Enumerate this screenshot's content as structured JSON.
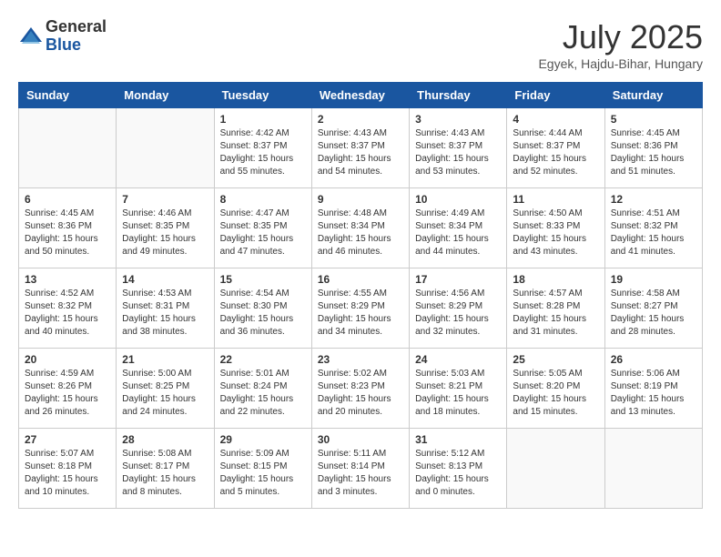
{
  "logo": {
    "general": "General",
    "blue": "Blue"
  },
  "title": {
    "month_year": "July 2025",
    "location": "Egyek, Hajdu-Bihar, Hungary"
  },
  "weekdays": [
    "Sunday",
    "Monday",
    "Tuesday",
    "Wednesday",
    "Thursday",
    "Friday",
    "Saturday"
  ],
  "weeks": [
    [
      {
        "day": "",
        "info": ""
      },
      {
        "day": "",
        "info": ""
      },
      {
        "day": "1",
        "info": "Sunrise: 4:42 AM\nSunset: 8:37 PM\nDaylight: 15 hours and 55 minutes."
      },
      {
        "day": "2",
        "info": "Sunrise: 4:43 AM\nSunset: 8:37 PM\nDaylight: 15 hours and 54 minutes."
      },
      {
        "day": "3",
        "info": "Sunrise: 4:43 AM\nSunset: 8:37 PM\nDaylight: 15 hours and 53 minutes."
      },
      {
        "day": "4",
        "info": "Sunrise: 4:44 AM\nSunset: 8:37 PM\nDaylight: 15 hours and 52 minutes."
      },
      {
        "day": "5",
        "info": "Sunrise: 4:45 AM\nSunset: 8:36 PM\nDaylight: 15 hours and 51 minutes."
      }
    ],
    [
      {
        "day": "6",
        "info": "Sunrise: 4:45 AM\nSunset: 8:36 PM\nDaylight: 15 hours and 50 minutes."
      },
      {
        "day": "7",
        "info": "Sunrise: 4:46 AM\nSunset: 8:35 PM\nDaylight: 15 hours and 49 minutes."
      },
      {
        "day": "8",
        "info": "Sunrise: 4:47 AM\nSunset: 8:35 PM\nDaylight: 15 hours and 47 minutes."
      },
      {
        "day": "9",
        "info": "Sunrise: 4:48 AM\nSunset: 8:34 PM\nDaylight: 15 hours and 46 minutes."
      },
      {
        "day": "10",
        "info": "Sunrise: 4:49 AM\nSunset: 8:34 PM\nDaylight: 15 hours and 44 minutes."
      },
      {
        "day": "11",
        "info": "Sunrise: 4:50 AM\nSunset: 8:33 PM\nDaylight: 15 hours and 43 minutes."
      },
      {
        "day": "12",
        "info": "Sunrise: 4:51 AM\nSunset: 8:32 PM\nDaylight: 15 hours and 41 minutes."
      }
    ],
    [
      {
        "day": "13",
        "info": "Sunrise: 4:52 AM\nSunset: 8:32 PM\nDaylight: 15 hours and 40 minutes."
      },
      {
        "day": "14",
        "info": "Sunrise: 4:53 AM\nSunset: 8:31 PM\nDaylight: 15 hours and 38 minutes."
      },
      {
        "day": "15",
        "info": "Sunrise: 4:54 AM\nSunset: 8:30 PM\nDaylight: 15 hours and 36 minutes."
      },
      {
        "day": "16",
        "info": "Sunrise: 4:55 AM\nSunset: 8:29 PM\nDaylight: 15 hours and 34 minutes."
      },
      {
        "day": "17",
        "info": "Sunrise: 4:56 AM\nSunset: 8:29 PM\nDaylight: 15 hours and 32 minutes."
      },
      {
        "day": "18",
        "info": "Sunrise: 4:57 AM\nSunset: 8:28 PM\nDaylight: 15 hours and 31 minutes."
      },
      {
        "day": "19",
        "info": "Sunrise: 4:58 AM\nSunset: 8:27 PM\nDaylight: 15 hours and 28 minutes."
      }
    ],
    [
      {
        "day": "20",
        "info": "Sunrise: 4:59 AM\nSunset: 8:26 PM\nDaylight: 15 hours and 26 minutes."
      },
      {
        "day": "21",
        "info": "Sunrise: 5:00 AM\nSunset: 8:25 PM\nDaylight: 15 hours and 24 minutes."
      },
      {
        "day": "22",
        "info": "Sunrise: 5:01 AM\nSunset: 8:24 PM\nDaylight: 15 hours and 22 minutes."
      },
      {
        "day": "23",
        "info": "Sunrise: 5:02 AM\nSunset: 8:23 PM\nDaylight: 15 hours and 20 minutes."
      },
      {
        "day": "24",
        "info": "Sunrise: 5:03 AM\nSunset: 8:21 PM\nDaylight: 15 hours and 18 minutes."
      },
      {
        "day": "25",
        "info": "Sunrise: 5:05 AM\nSunset: 8:20 PM\nDaylight: 15 hours and 15 minutes."
      },
      {
        "day": "26",
        "info": "Sunrise: 5:06 AM\nSunset: 8:19 PM\nDaylight: 15 hours and 13 minutes."
      }
    ],
    [
      {
        "day": "27",
        "info": "Sunrise: 5:07 AM\nSunset: 8:18 PM\nDaylight: 15 hours and 10 minutes."
      },
      {
        "day": "28",
        "info": "Sunrise: 5:08 AM\nSunset: 8:17 PM\nDaylight: 15 hours and 8 minutes."
      },
      {
        "day": "29",
        "info": "Sunrise: 5:09 AM\nSunset: 8:15 PM\nDaylight: 15 hours and 5 minutes."
      },
      {
        "day": "30",
        "info": "Sunrise: 5:11 AM\nSunset: 8:14 PM\nDaylight: 15 hours and 3 minutes."
      },
      {
        "day": "31",
        "info": "Sunrise: 5:12 AM\nSunset: 8:13 PM\nDaylight: 15 hours and 0 minutes."
      },
      {
        "day": "",
        "info": ""
      },
      {
        "day": "",
        "info": ""
      }
    ]
  ]
}
